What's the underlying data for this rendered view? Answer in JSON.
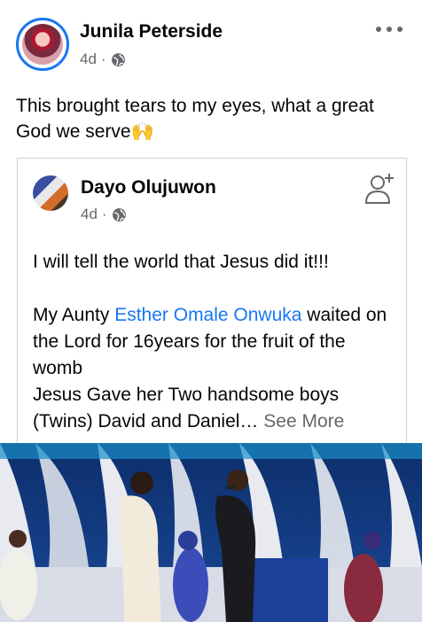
{
  "post": {
    "author": "Junila Peterside",
    "time": "4d",
    "separator": "·",
    "text": "This brought tears to my eyes, what a great God we serve🙌"
  },
  "shared": {
    "author": "Dayo Olujuwon",
    "time": "4d",
    "separator": "·",
    "line1": "I will tell the world that Jesus did it!!!",
    "line2_prefix": "My Aunty ",
    "mention": "Esther Omale Onwuka",
    "line2_suffix": " waited on the Lord for 16years for the fruit of the womb",
    "line3": "Jesus Gave her Two handsome boys (Twins) David and Daniel… ",
    "see_more": "See More"
  },
  "colors": {
    "accent": "#1877f2",
    "secondary_text": "#65676b",
    "border": "#ced0d4"
  },
  "icons": [
    "globe-icon",
    "more-options-icon",
    "add-friend-icon"
  ]
}
